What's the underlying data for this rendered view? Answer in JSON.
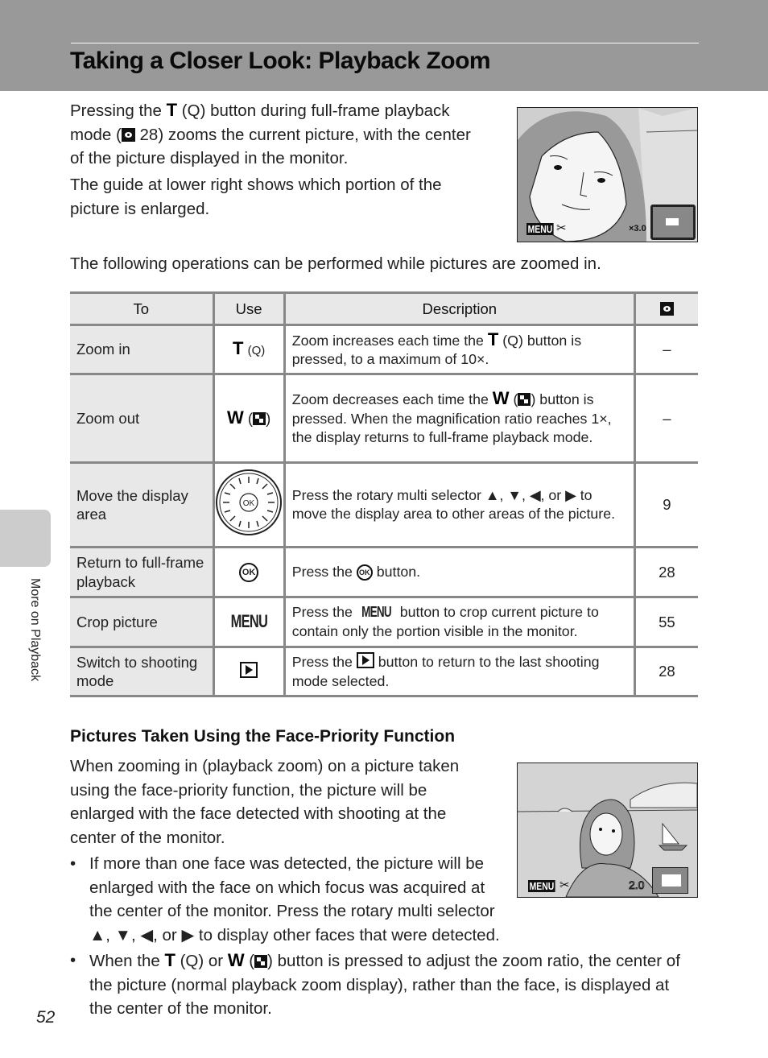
{
  "header": {
    "title": "Taking a Closer Look: Playback Zoom"
  },
  "intro": {
    "p1_a": "Pressing the ",
    "p1_T": "T",
    "p1_b": " (",
    "p1_zoom_icon": "Q",
    "p1_c": ") button during full-frame playback mode (",
    "p1_ref": "28",
    "p1_d": ") zooms the current picture, with the center of the picture displayed in the monitor.",
    "p2": "The guide at lower right shows which portion of the picture is enlarged.",
    "p3": "The following operations can be performed while pictures are zoomed in."
  },
  "screenshot1": {
    "menu_label": "MENU",
    "crop_symbol": "✂",
    "zoom_ratio": "×3.0"
  },
  "table": {
    "headers": {
      "to": "To",
      "use": "Use",
      "description": "Description",
      "ref_icon": "reference-icon"
    },
    "rows": [
      {
        "to": "Zoom in",
        "use_key": "T",
        "use_icon": "(Q)",
        "desc_a": "Zoom increases each time the ",
        "desc_key": "T",
        "desc_icon": " (Q)",
        "desc_b": " button is pressed, to a maximum of 10×.",
        "ref": "–"
      },
      {
        "to": "Zoom out",
        "use_key": "W",
        "desc_a": "Zoom decreases each time the ",
        "desc_key": "W",
        "desc_b": " button is pressed. When the magnification ratio reaches 1×, the display returns to full-frame playback mode.",
        "ref": "–"
      },
      {
        "to": "Move the display area",
        "use_icon": "OK",
        "desc_a": "Press the rotary multi selector ▲, ▼, ◀, or ▶ to move the display area to other areas of the picture.",
        "ref": "9"
      },
      {
        "to": "Return to full-frame playback",
        "use_icon": "OK",
        "desc_a": "Press the ",
        "desc_icon": "OK",
        "desc_b": " button.",
        "ref": "28"
      },
      {
        "to": "Crop picture",
        "use_icon": "MENU",
        "desc_a": "Press the ",
        "desc_icon": "MENU",
        "desc_b": " button to crop current picture to contain only the portion visible in the monitor.",
        "ref": "55"
      },
      {
        "to": "Switch to shooting mode",
        "desc_a": "Press the ",
        "desc_b": " button to return to the last shooting mode selected.",
        "ref": "28"
      }
    ]
  },
  "face_section": {
    "heading": "Pictures Taken Using the Face-Priority Function",
    "intro": "When zooming in (playback zoom) on a picture taken using the face-priority function, the picture will be enlarged with the face detected with shooting at the center of the monitor.",
    "bullets": [
      {
        "text": "If more than one face was detected, the picture will be enlarged with the face on which focus was acquired at the center of the monitor. Press the rotary multi selector ▲, ▼, ◀, or ▶ to display other faces that were detected."
      },
      {
        "a": "When the ",
        "T": "T",
        "b": " (Q) or ",
        "W": "W",
        "c": " (",
        "d": ") button is pressed to adjust the zoom ratio, the center of the picture (normal playback zoom display), rather than the face, is displayed at the center of the monitor."
      }
    ]
  },
  "screenshot2": {
    "menu_label": "MENU",
    "crop_symbol": "✂",
    "zoom_ratio": "2.0"
  },
  "side_tab": {
    "label": "More on Playback"
  },
  "page_number": "52"
}
